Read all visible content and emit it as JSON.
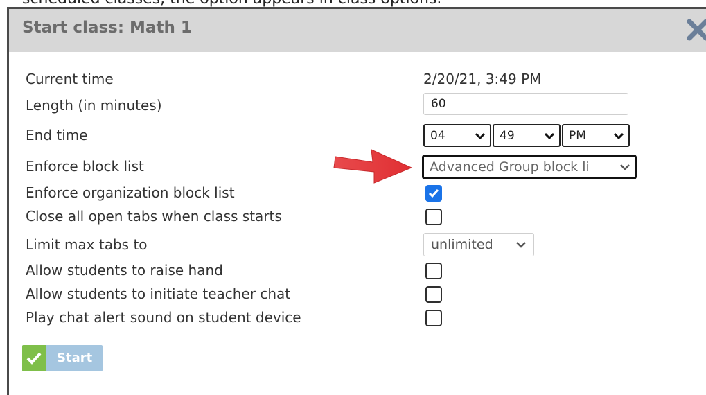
{
  "caption": "scheduled classes, the option appears in class options.",
  "dialog": {
    "title": "Start class: Math 1",
    "close_icon": "close-icon"
  },
  "form": {
    "current_time_label": "Current time",
    "current_time_value": "2/20/21, 3:49 PM",
    "length_label": "Length (in minutes)",
    "length_value": "60",
    "end_time_label": "End time",
    "end_hour": "04",
    "end_minute": "49",
    "end_ampm": "PM",
    "block_list_label": "Enforce block list",
    "block_list_value": "Advanced Group block li",
    "org_block_list_label": "Enforce organization block list",
    "org_block_list_checked": true,
    "close_tabs_label": "Close all open tabs when class starts",
    "close_tabs_checked": false,
    "max_tabs_label": "Limit max tabs to",
    "max_tabs_value": "unlimited",
    "raise_hand_label": "Allow students to raise hand",
    "raise_hand_checked": false,
    "teacher_chat_label": "Allow students to initiate teacher chat",
    "teacher_chat_checked": false,
    "chat_sound_label": "Play chat alert sound on student device",
    "chat_sound_checked": false
  },
  "start_button": {
    "label": "Start",
    "icon": "check-icon"
  },
  "colors": {
    "titlebar": "#d7d7d7",
    "checkbox_checked": "#1a73e8",
    "start_button": "#a5c6e0",
    "start_check": "#7fbf4a",
    "annotation_arrow": "#e8383b"
  }
}
